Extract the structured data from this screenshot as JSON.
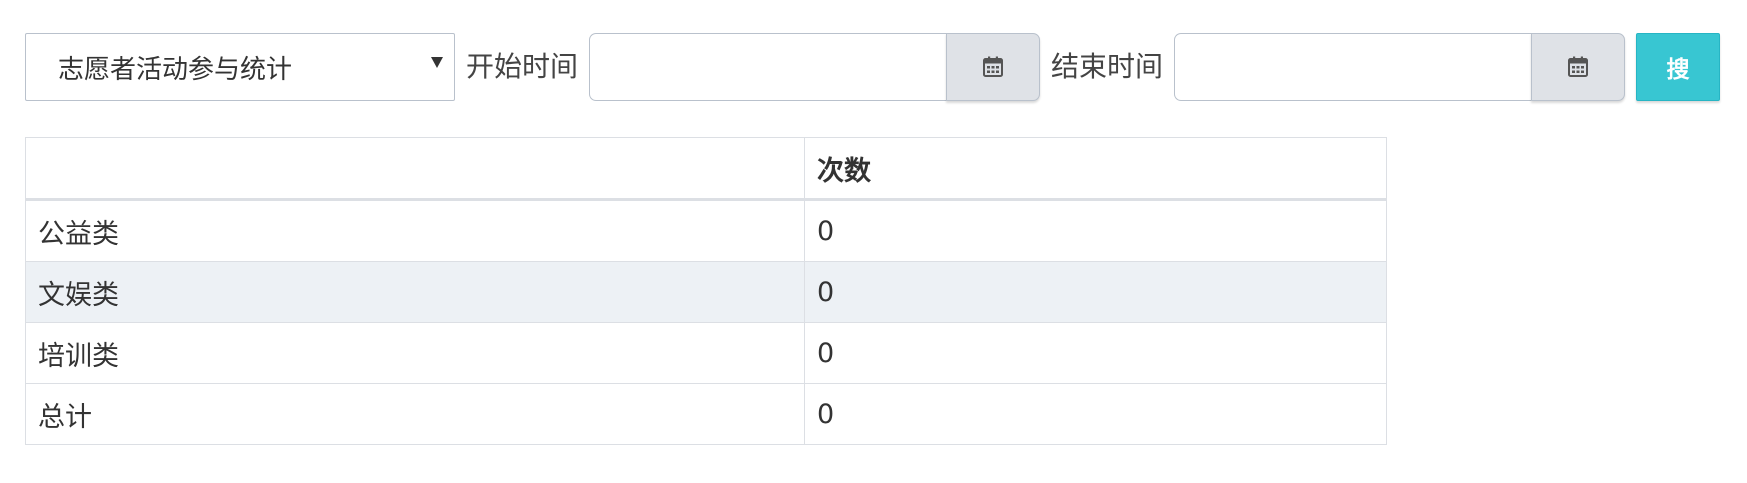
{
  "filter": {
    "report_type": "志愿者活动参与统计",
    "start_label": "开始时间",
    "start_value": "",
    "end_label": "结束时间",
    "end_value": "",
    "search_label": "搜"
  },
  "icons": {
    "report_dropdown": "caret-down-icon",
    "date_picker": "calendar-icon"
  },
  "colors": {
    "search_button": "#38c6d2",
    "calendar_button": "#dfe2e7",
    "striped_row": "#edf1f5"
  },
  "table": {
    "headers": [
      "",
      "次数"
    ],
    "rows": [
      {
        "category": "公益类",
        "count": "0"
      },
      {
        "category": "文娱类",
        "count": "0"
      },
      {
        "category": "培训类",
        "count": "0"
      },
      {
        "category": "总计",
        "count": "0"
      }
    ]
  }
}
